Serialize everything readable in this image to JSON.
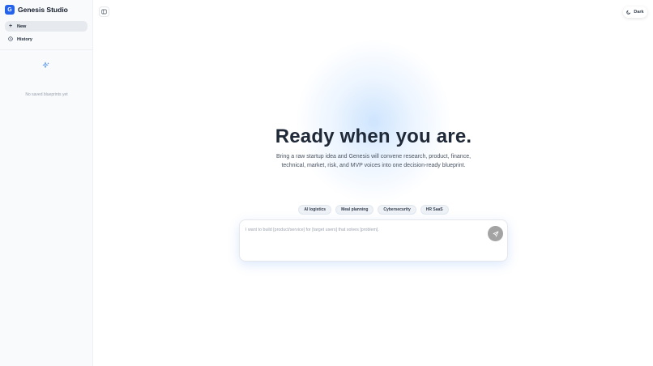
{
  "app": {
    "logo_letter": "G",
    "name": "Genesis Studio"
  },
  "sidebar": {
    "items": [
      {
        "label": "New",
        "icon": "plus-icon"
      },
      {
        "label": "History",
        "icon": "history-icon"
      }
    ],
    "empty_icon": "sparkle-icon",
    "empty_text": "No saved blueprints yet"
  },
  "topbar": {
    "sidebar_toggle_icon": "sidebar-toggle-icon",
    "theme_label": "Dark",
    "theme_icon": "moon-icon"
  },
  "hero": {
    "title": "Ready when you are.",
    "subtitle": "Bring a raw startup idea and Genesis will convene research, product, finance, technical, market, risk, and MVP voices into one decision-ready blueprint."
  },
  "suggestions": [
    "AI logistics",
    "Meal planning",
    "Cybersecurity",
    "HR SaaS"
  ],
  "composer": {
    "placeholder": "I want to build [product/service] for [target users] that solves [problem].",
    "send_icon": "send-icon"
  },
  "colors": {
    "accent": "#2563eb",
    "send_disabled": "#a3a3a3",
    "sidebar_bg": "#f8fafc"
  }
}
